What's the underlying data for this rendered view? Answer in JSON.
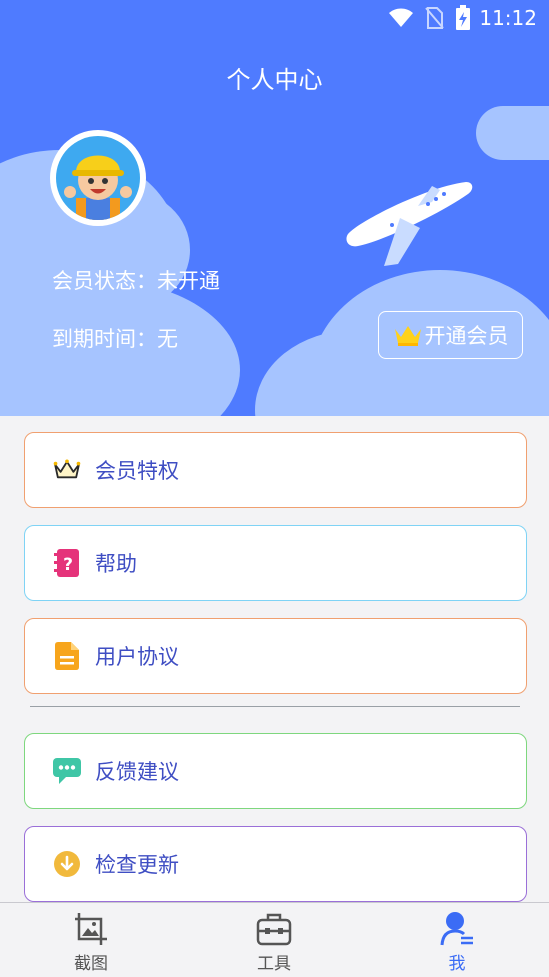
{
  "status_bar": {
    "time": "11:12"
  },
  "header": {
    "title": "个人中心",
    "member_status": "会员状态：未开通",
    "expire_time": "到期时间：无",
    "open_member_label": "开通会员"
  },
  "menu": [
    {
      "label": "会员特权",
      "icon": "crown-icon",
      "border": "#f0a070"
    },
    {
      "label": "帮助",
      "icon": "help-book-icon",
      "border": "#7fd3f5"
    },
    {
      "label": "用户协议",
      "icon": "document-icon",
      "border": "#f0a070"
    },
    {
      "label": "反馈建议",
      "icon": "chat-bubble-icon",
      "border": "#7ed77e"
    },
    {
      "label": "检查更新",
      "icon": "download-circle-icon",
      "border": "#9a6fd8"
    }
  ],
  "tabs": [
    {
      "label": "截图",
      "icon": "screenshot-icon",
      "active": false
    },
    {
      "label": "工具",
      "icon": "toolbox-icon",
      "active": false
    },
    {
      "label": "我",
      "icon": "profile-icon",
      "active": true
    }
  ],
  "colors": {
    "header_bg": "#4f7bff",
    "accent_text": "#3f4ec3",
    "active_tab": "#3b6cf5"
  }
}
